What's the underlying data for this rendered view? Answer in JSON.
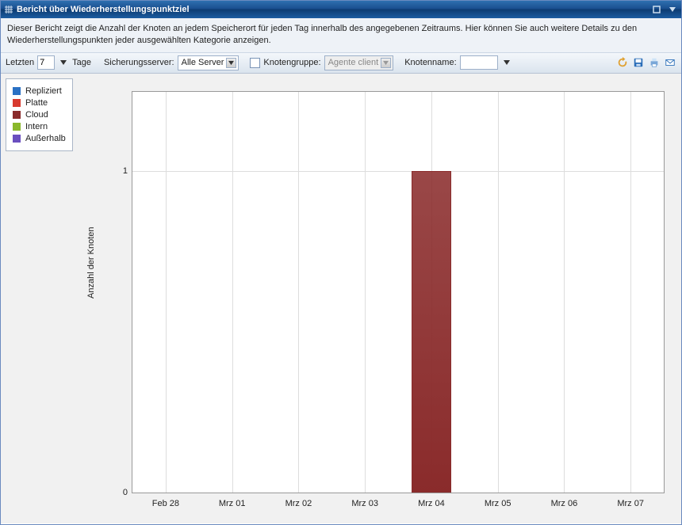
{
  "window": {
    "title": "Bericht über Wiederherstellungspunktziel",
    "description": "Dieser Bericht zeigt die Anzahl der Knoten an jedem Speicherort für jeden Tag innerhalb des angegebenen Zeitraums. Hier können Sie auch weitere Details zu den Wiederherstellungspunkten jeder ausgewählten Kategorie anzeigen."
  },
  "filters": {
    "last_label_prefix": "Letzten",
    "last_value": "7",
    "last_label_suffix": "Tage",
    "backup_server_label": "Sicherungsserver:",
    "backup_server_value": "Alle Server",
    "nodegroup_label": "Knotengruppe:",
    "nodegroup_value": "Agente client",
    "nodename_label": "Knotenname:",
    "nodename_value": ""
  },
  "legend": {
    "items": [
      {
        "label": "Repliziert",
        "color": "#2a71c4"
      },
      {
        "label": "Platte",
        "color": "#d83a2f"
      },
      {
        "label": "Cloud",
        "color": "#8a2b2b"
      },
      {
        "label": "Intern",
        "color": "#8ab82b"
      },
      {
        "label": "Außerhalb",
        "color": "#6a4fbf"
      }
    ]
  },
  "axes": {
    "ylabel": "Anzahl der Knoten",
    "ytick0": "0",
    "ytick1": "1",
    "xticks": [
      "Feb 28",
      "Mrz 01",
      "Mrz 02",
      "Mrz 03",
      "Mrz 04",
      "Mrz 05",
      "Mrz 06",
      "Mrz 07"
    ]
  },
  "chart_data": {
    "type": "bar",
    "categories": [
      "Feb 28",
      "Mrz 01",
      "Mrz 02",
      "Mrz 03",
      "Mrz 04",
      "Mrz 05",
      "Mrz 06",
      "Mrz 07"
    ],
    "series": [
      {
        "name": "Repliziert",
        "color": "#2a71c4",
        "values": [
          0,
          0,
          0,
          0,
          0,
          0,
          0,
          0
        ]
      },
      {
        "name": "Platte",
        "color": "#d83a2f",
        "values": [
          0,
          0,
          0,
          0,
          0,
          0,
          0,
          0
        ]
      },
      {
        "name": "Cloud",
        "color": "#8a2b2b",
        "values": [
          0,
          0,
          0,
          0,
          1,
          0,
          0,
          0
        ]
      },
      {
        "name": "Intern",
        "color": "#8ab82b",
        "values": [
          0,
          0,
          0,
          0,
          0,
          0,
          0,
          0
        ]
      },
      {
        "name": "Außerhalb",
        "color": "#6a4fbf",
        "values": [
          0,
          0,
          0,
          0,
          0,
          0,
          0,
          0
        ]
      }
    ],
    "ylabel": "Anzahl der Knoten",
    "xlabel": "",
    "ylim": [
      0,
      1
    ],
    "title": ""
  }
}
